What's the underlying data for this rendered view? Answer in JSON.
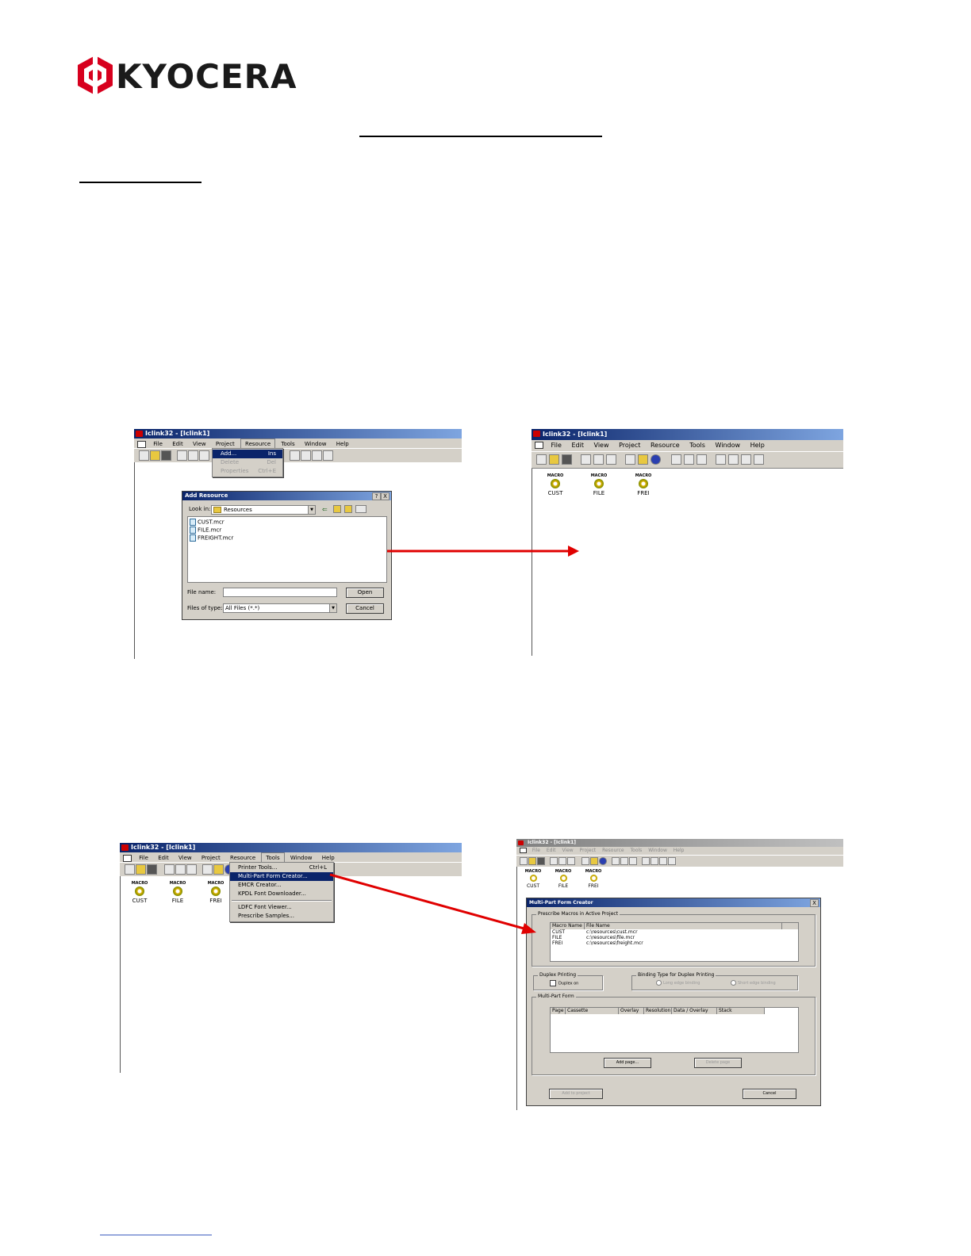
{
  "logo": {
    "brand": "KYOCERA",
    "color": "#d7001e"
  },
  "screens": {
    "s1": {
      "title": "Iclink32 - [Iclink1]",
      "menu": [
        "File",
        "Edit",
        "View",
        "Project",
        "Resource",
        "Tools",
        "Window",
        "Help"
      ],
      "resource_menu": [
        {
          "label": "Add...",
          "shortcut": "Ins"
        },
        {
          "label": "Delete",
          "shortcut": "Del"
        },
        {
          "label": "Properties",
          "shortcut": "Ctrl+E"
        }
      ],
      "dialog": {
        "title": "Add Resource",
        "help": "?",
        "close": "X",
        "look_in_label": "Look in:",
        "look_in_value": "Resources",
        "files": [
          "CUST.mcr",
          "FILE.mcr",
          "FREIGHT.mcr"
        ],
        "file_name_label": "File name:",
        "file_name_value": "",
        "files_of_type_label": "Files of type:",
        "files_of_type_value": "All Files (*.*)",
        "open": "Open",
        "cancel": "Cancel"
      }
    },
    "s2": {
      "title": "Iclink32 - [Iclink1]",
      "menu": [
        "File",
        "Edit",
        "View",
        "Project",
        "Resource",
        "Tools",
        "Window",
        "Help"
      ],
      "macros": [
        {
          "type": "MACRO",
          "name": "CUST"
        },
        {
          "type": "MACRO",
          "name": "FILE"
        },
        {
          "type": "MACRO",
          "name": "FREI"
        }
      ]
    },
    "s3": {
      "title": "Iclink32 - [Iclink1]",
      "menu": [
        "File",
        "Edit",
        "View",
        "Project",
        "Resource",
        "Tools",
        "Window",
        "Help"
      ],
      "tools_menu": [
        {
          "label": "Printer Tools...",
          "shortcut": "Ctrl+L"
        },
        {
          "label": "Multi-Part Form Creator...",
          "shortcut": ""
        },
        {
          "label": "EMCR Creator...",
          "shortcut": ""
        },
        {
          "label": "KPDL Font Downloader...",
          "shortcut": ""
        },
        {
          "label": "LDFC Font Viewer...",
          "shortcut": ""
        },
        {
          "label": "Prescribe Samples...",
          "shortcut": ""
        }
      ],
      "macros": [
        {
          "type": "MACRO",
          "name": "CUST"
        },
        {
          "type": "MACRO",
          "name": "FILE"
        },
        {
          "type": "MACRO",
          "name": "FREI"
        }
      ]
    },
    "s4": {
      "title": "Iclink32 - [Iclink1]",
      "menu": [
        "File",
        "Edit",
        "View",
        "Project",
        "Resource",
        "Tools",
        "Window",
        "Help"
      ],
      "macros": [
        {
          "type": "MACRO",
          "name": "CUST"
        },
        {
          "type": "MACRO",
          "name": "FILE"
        },
        {
          "type": "MACRO",
          "name": "FREI"
        }
      ],
      "dialog": {
        "title": "Multi-Part Form Creator",
        "close": "X",
        "macros_group": "Prescribe Macros in Active Project",
        "macro_cols": [
          "Macro Name",
          "File Name"
        ],
        "macro_rows": [
          [
            "CUST",
            "c:\\resources\\cust.mcr"
          ],
          [
            "FILE",
            "c:\\resources\\file.mcr"
          ],
          [
            "FREI",
            "c:\\resources\\freight.mcr"
          ]
        ],
        "duplex_group": "Duplex Printing",
        "duplex_on": "Duplex on",
        "binding_group": "Binding Type for Duplex Printing",
        "long_edge": "Long edge binding",
        "short_edge": "Short edge binding",
        "form_group": "Multi-Part Form",
        "form_cols": [
          "Page",
          "Cassette",
          "Overlay",
          "Resolution",
          "Data / Overlay",
          "Stack"
        ],
        "add_page": "Add page...",
        "delete_page": "Delete page",
        "add_to_project": "Add to project",
        "cancel": "Cancel"
      }
    }
  }
}
